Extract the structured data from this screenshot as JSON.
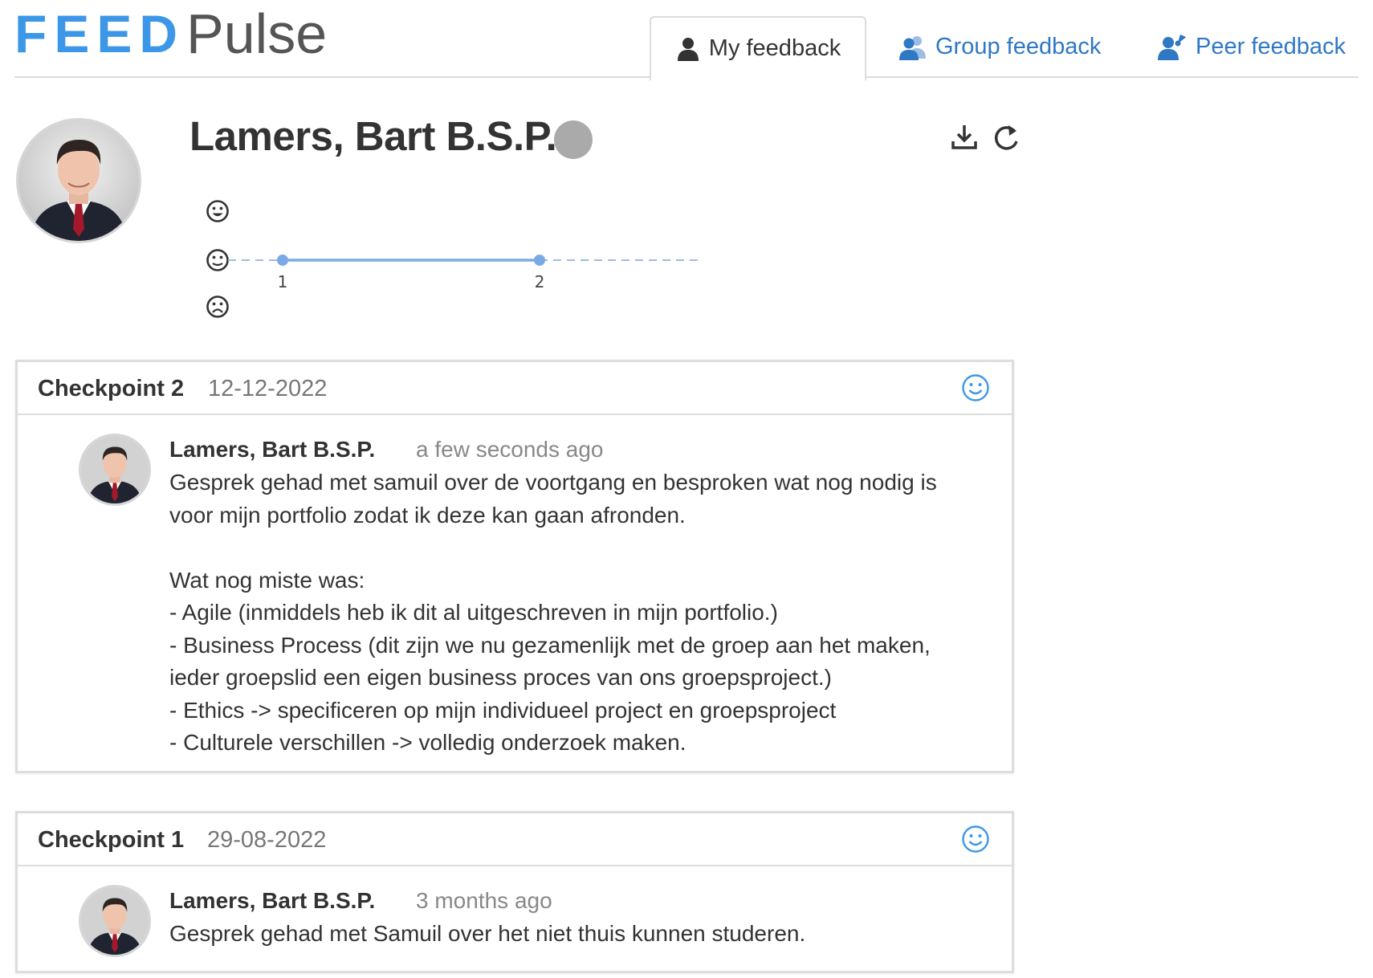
{
  "app": {
    "logo_feed": "FEED",
    "logo_pulse": "Pulse",
    "accent_color": "#3d97e8",
    "link_color": "#2f78c4"
  },
  "tabs": [
    {
      "label": "My feedback",
      "icon": "person-icon",
      "active": true
    },
    {
      "label": "Group feedback",
      "icon": "group-icon",
      "active": false
    },
    {
      "label": "Peer feedback",
      "icon": "peer-icon",
      "active": false
    }
  ],
  "profile": {
    "name": "Lamers, Bart B.S.P.",
    "status_color": "#aaaaaa",
    "actions": [
      {
        "name": "download-icon"
      },
      {
        "name": "refresh-icon"
      }
    ]
  },
  "chart_data": {
    "type": "line",
    "x": [
      1,
      2
    ],
    "categories": [
      "1",
      "2"
    ],
    "series": [
      {
        "values": [
          2,
          2
        ]
      }
    ],
    "y_levels": [
      "happy",
      "neutral",
      "sad"
    ],
    "y_level_icons": [
      "happy-face-icon",
      "neutral-face-icon",
      "sad-face-icon"
    ],
    "line_color": "#7aaae6",
    "grid": false
  },
  "checkpoints": [
    {
      "title": "Checkpoint 2",
      "date": "12-12-2022",
      "mood_icon": "smile-icon",
      "entries": [
        {
          "author": "Lamers, Bart B.S.P.",
          "time": "a few seconds ago",
          "lines": [
            "Gesprek gehad met samuil over de voortgang en besproken wat nog nodig is",
            "voor mijn portfolio zodat ik deze kan gaan afronden.",
            "",
            "Wat nog miste was:",
            "- Agile (inmiddels heb ik dit al uitgeschreven in mijn portfolio.)",
            "- Business Process (dit zijn we nu gezamenlijk met de groep aan het maken,",
            "ieder groepslid een eigen business proces van ons groepsproject.)",
            "- Ethics -> specificeren op mijn individueel project en groepsproject",
            "- Culturele verschillen -> volledig onderzoek maken."
          ]
        }
      ]
    },
    {
      "title": "Checkpoint 1",
      "date": "29-08-2022",
      "mood_icon": "smile-icon",
      "entries": [
        {
          "author": "Lamers, Bart B.S.P.",
          "time": "3 months ago",
          "lines": [
            "Gesprek gehad met Samuil over het niet thuis kunnen studeren."
          ]
        }
      ]
    }
  ]
}
